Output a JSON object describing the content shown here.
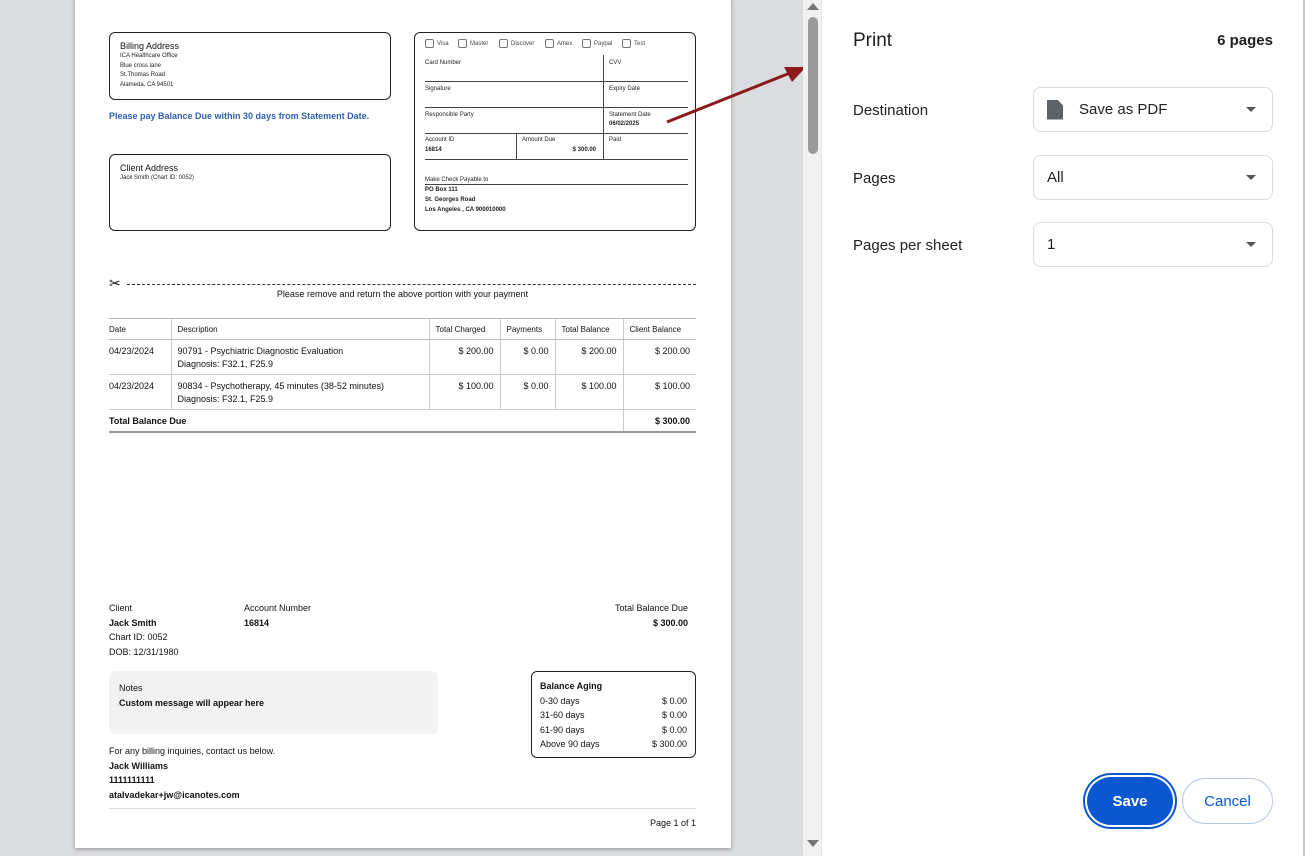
{
  "statement": {
    "billing_address_title": "Billing Address",
    "billing_address_lines": [
      "ICA Healthcare Office",
      "Blue cross lane",
      "St.Thomas Road",
      "Alameda, CA 94501"
    ],
    "pay_notice": "Please pay Balance Due within 30 days from Statement Date.",
    "client_address_title": "Client Address",
    "client_address_line": "Jack Smith (Chart ID: 0052)",
    "card_types": [
      "Visa",
      "Master",
      "Discover",
      "Amex",
      "Paypal",
      "Test"
    ],
    "card_number_label": "Card Number",
    "cvv_label": "CVV",
    "signature_label": "Signature",
    "expiry_label": "Expiry Date",
    "responsible_label": "Responsible Party",
    "statement_date_label": "Statement Date",
    "statement_date": "06/02/2025",
    "account_id_label": "Account ID",
    "account_id": "16814",
    "amount_due_label": "Amount Due",
    "amount_due": "$ 300.00",
    "paid_label": "Paid",
    "check_payable_label": "Make Check Payable to",
    "check_payable_lines": [
      "PO Box 111",
      "St. Georges Road",
      "Los Angeles , CA 900010000"
    ],
    "cut_notice": "Please remove and return the above portion with your payment",
    "table": {
      "headers": [
        "Date",
        "Description",
        "Total Charged",
        "Payments",
        "Total Balance",
        "Client Balance"
      ],
      "rows": [
        {
          "date": "04/23/2024",
          "desc": "90791 - Psychiatric Diagnostic Evaluation",
          "diag": "Diagnosis: F32.1, F25.9",
          "charged": "$ 200.00",
          "payments": "$ 0.00",
          "balance": "$ 200.00",
          "client": "$ 200.00"
        },
        {
          "date": "04/23/2024",
          "desc": "90834 - Psychotherapy, 45 minutes (38-52 minutes)",
          "diag": "Diagnosis: F32.1, F25.9",
          "charged": "$ 100.00",
          "payments": "$ 0.00",
          "balance": "$ 100.00",
          "client": "$ 100.00"
        }
      ],
      "total_label": "Total Balance Due",
      "total_value": "$ 300.00"
    },
    "summary": {
      "client_label": "Client",
      "client_name": "Jack Smith",
      "chart_id": "Chart ID: 0052",
      "dob": "DOB: 12/31/1980",
      "account_label": "Account Number",
      "account_value": "16814",
      "total_label": "Total Balance Due",
      "total_value": "$ 300.00"
    },
    "notes_label": "Notes",
    "notes_text": "Custom message will appear here",
    "aging": {
      "title": "Balance Aging",
      "rows": [
        {
          "label": "0-30 days",
          "value": "$ 0.00"
        },
        {
          "label": "31-60 days",
          "value": "$ 0.00"
        },
        {
          "label": "61-90 days",
          "value": "$ 0.00"
        },
        {
          "label": "Above 90 days",
          "value": "$ 300.00"
        }
      ]
    },
    "contact": {
      "intro": "For any billing inquiries, contact us below.",
      "name": "Jack Williams",
      "phone": "1111111111",
      "email": "atalvadekar+jw@icanotes.com"
    },
    "page_label": "Page 1 of 1"
  },
  "print": {
    "title": "Print",
    "page_count": "6 pages",
    "destination_label": "Destination",
    "destination_value": "Save as PDF",
    "pages_label": "Pages",
    "pages_value": "All",
    "per_sheet_label": "Pages per sheet",
    "per_sheet_value": "1",
    "save_label": "Save",
    "cancel_label": "Cancel"
  },
  "colors": {
    "accent": "#0b57d0",
    "notice": "#2d5fb4",
    "arrow": "#8b1a1a"
  }
}
